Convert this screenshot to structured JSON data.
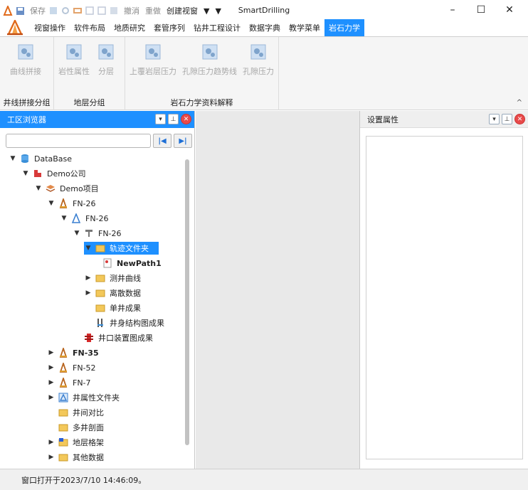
{
  "window": {
    "title": "SmartDrilling",
    "minimize": "–",
    "maximize": "☐",
    "close": "✕"
  },
  "quick_access": {
    "save": "保存",
    "undo": "撤消",
    "redo": "重做",
    "create_view": "创建视窗",
    "dropdown": "▼",
    "more": "▼"
  },
  "tabs": [
    {
      "label": "视窗操作",
      "active": false
    },
    {
      "label": "软件布局",
      "active": false
    },
    {
      "label": "地质研究",
      "active": false
    },
    {
      "label": "套管序列",
      "active": false
    },
    {
      "label": "钻井工程设计",
      "active": false
    },
    {
      "label": "数据字典",
      "active": false
    },
    {
      "label": "教学菜单",
      "active": false
    },
    {
      "label": "岩石力学",
      "active": true
    }
  ],
  "ribbon": {
    "groups": [
      {
        "label": "井线拼接分组",
        "buttons": [
          "曲线拼接"
        ]
      },
      {
        "label": "地层分组",
        "buttons": [
          "岩性属性",
          "分层"
        ]
      },
      {
        "label": "岩石力学资料解释",
        "buttons": [
          "上覆岩层压力",
          "孔隙压力趋势线",
          "孔隙压力"
        ]
      }
    ],
    "collapse": "^"
  },
  "left_panel": {
    "title": "工区浏览器",
    "search": {
      "value": "",
      "placeholder": ""
    },
    "nav_first": "|◀",
    "nav_last": "▶|",
    "tree": [
      {
        "label": "DataBase",
        "icon": "database-icon",
        "arrow": "▼"
      },
      {
        "label": "Demo公司",
        "icon": "company-icon",
        "arrow": "▼"
      },
      {
        "label": "Demo项目",
        "icon": "project-icon",
        "arrow": "▼"
      },
      {
        "label": "FN-26",
        "icon": "rig-icon",
        "arrow": "▼"
      },
      {
        "label": "FN-26",
        "icon": "well-icon",
        "arrow": "▼"
      },
      {
        "label": "FN-26",
        "icon": "wellbore-icon",
        "arrow": "▼"
      },
      {
        "label": "轨迹文件夹",
        "icon": "folder-icon",
        "arrow": "▼",
        "selected": true
      },
      {
        "label": "NewPath1",
        "icon": "path-file-icon",
        "arrow": "",
        "bold": true
      },
      {
        "label": "测井曲线",
        "icon": "folder-icon",
        "arrow": "▶"
      },
      {
        "label": "离散数据",
        "icon": "folder-icon",
        "arrow": "▶"
      },
      {
        "label": "单井成果",
        "icon": "folder-icon",
        "arrow": ""
      },
      {
        "label": "井身结构图成果",
        "icon": "structure-icon",
        "arrow": ""
      },
      {
        "label": "井口装置图成果",
        "icon": "wellhead-icon",
        "arrow": ""
      },
      {
        "label": "FN-35",
        "icon": "rig-icon",
        "arrow": "▶",
        "bold": true
      },
      {
        "label": "FN-52",
        "icon": "rig-icon",
        "arrow": "▶"
      },
      {
        "label": "FN-7",
        "icon": "rig-icon",
        "arrow": "▶"
      },
      {
        "label": "井属性文件夹",
        "icon": "attr-folder-icon",
        "arrow": "▶"
      },
      {
        "label": "井间对比",
        "icon": "folder-icon",
        "arrow": ""
      },
      {
        "label": "多井剖面",
        "icon": "folder-icon",
        "arrow": ""
      },
      {
        "label": "地层格架",
        "icon": "strata-icon",
        "arrow": "▶"
      },
      {
        "label": "其他数据",
        "icon": "folder-icon",
        "arrow": "▶"
      }
    ]
  },
  "right_panel": {
    "title": "设置属性"
  },
  "status": {
    "text": "窗口打开于2023/7/10 14:46:09。"
  },
  "colors": {
    "accent": "#1e90ff",
    "ribbon_bg": "#f5f5f5",
    "center_bg": "#e9e9e9"
  }
}
